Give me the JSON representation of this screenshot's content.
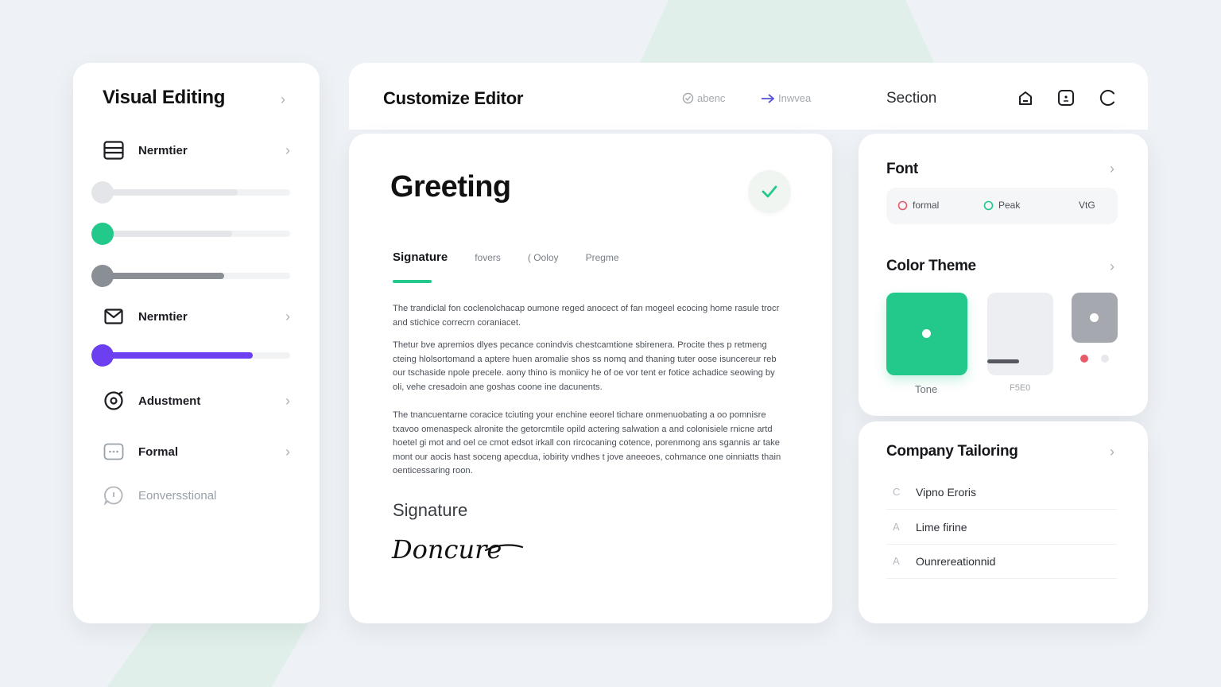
{
  "left_panel": {
    "title": "Visual Editing",
    "items": [
      {
        "label": "Nermtier",
        "icon": "list-icon"
      },
      {
        "label": "Nermtier",
        "icon": "mail-icon"
      },
      {
        "label": "Adustment",
        "icon": "target-icon"
      },
      {
        "label": "Formal",
        "icon": "chat-dots-icon"
      },
      {
        "label": "Eonversstional",
        "icon": "speech-bubble-icon"
      }
    ],
    "sliders": [
      {
        "value": 0.0,
        "color": "#e3e5e8",
        "fill": "#e3e5e8",
        "fill_level": 0.72
      },
      {
        "value": 0.0,
        "color": "#22c98a",
        "fill": "#e3e5e8",
        "fill_level": 0.69
      },
      {
        "value": 0.0,
        "color": "#8a8e95",
        "fill": "#8a8e95",
        "fill_level": 0.65
      },
      {
        "value": 0.0,
        "color": "#6c3ff0",
        "fill": "#6c3ff0",
        "fill_level": 0.8
      }
    ]
  },
  "header": {
    "title": "Customize Editor",
    "link1": "abenc",
    "link2": "Inwvea",
    "section": "Section"
  },
  "editor": {
    "heading": "Greeting",
    "tabs": [
      "Signature",
      "fovers",
      "( Ooloy",
      "Pregme"
    ],
    "paragraphs": [
      "The trandiclal fon coclenolchacap oumone reged anocect of fan mogeel ecocing home rasule trocr and stichice correcrn coraniacet.",
      "Thetur bve apremios dlyes pecance conindvis chestcamtione sbirenera. Procite thes p retmeng cteing hlolsortomand a aptere huen aromalie shos ss nomq and thaning tuter oose isuncereur reb our tschaside npole precele. aony thino is moniicy he of oe vor tent er fotice achadice seowing by oli, vehe cresadoin ane goshas coone ine dacunents.",
      "The tnancuentarne coracice tciuting your enchine eeorel tichare onmenuobating a oo pomnisre txavoo omenaspeck alronite the getorcmtile opild actering salwation a and colonisiele rnicne artd hoetel gi mot and oel ce cmot edsot irkall con rircocaning cotence, porenmong ans sgannis ar take mont our aocis hast soceng apecdua, iobirity vndhes t jove aneeoes, cohmance one oinniatts thain oenticessaring roon."
    ],
    "signature_heading": "Signature",
    "signature_script": "Doncure"
  },
  "right_top": {
    "font_title": "Font",
    "font_options": [
      "formal",
      "Peak",
      "VtG"
    ],
    "color_title": "Color Theme",
    "swatch_labels": [
      "Tone",
      "F5E0"
    ],
    "colors": {
      "accent": "#22c98a",
      "gray": "#a5a9af",
      "light": "#eceef1",
      "dot_red": "#e65b6a"
    }
  },
  "right_bottom": {
    "title": "Company Tailoring",
    "items": [
      {
        "icon": "C",
        "label": "Vipno Eroris"
      },
      {
        "icon": "A",
        "label": "Lime firine"
      },
      {
        "icon": "A",
        "label": "Ounrereationnid"
      }
    ]
  }
}
